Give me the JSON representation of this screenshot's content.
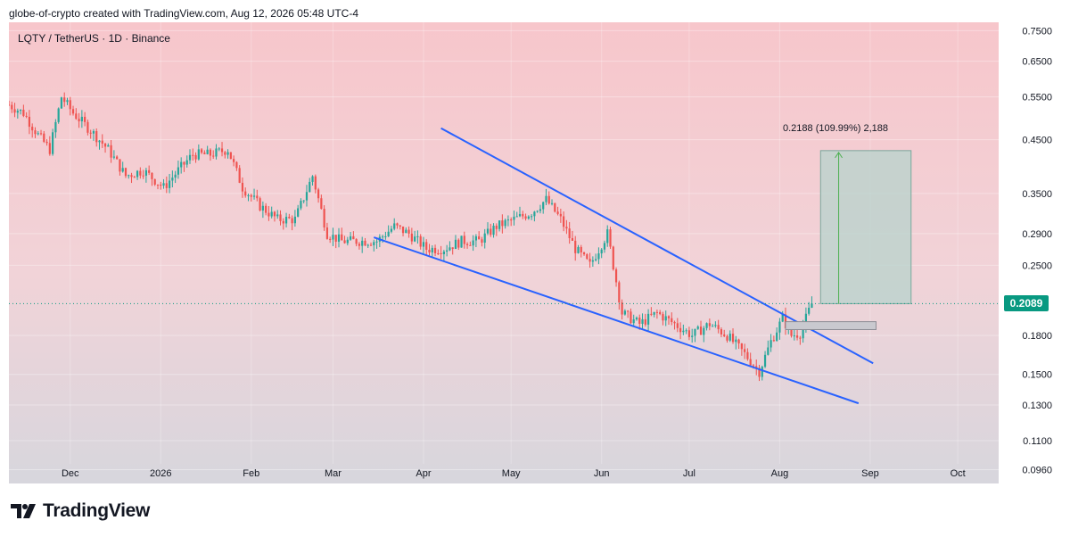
{
  "header": {
    "attribution": "globe-of-crypto created with TradingView.com, Aug 12, 2026 05:48 UTC-4"
  },
  "symbol_label": "LQTY / TetherUS · 1D · Binance",
  "footer": {
    "brand": "TradingView",
    "logo_icon": "tradingview-logo-icon"
  },
  "current_price": "0.2089",
  "measure": {
    "label": "0.2188 (109.99%) 2,188",
    "from": 0.2089,
    "to": 0.4277
  },
  "colors": {
    "up": "#26a69a",
    "down": "#ef5350",
    "trendline": "#2962ff",
    "badge": "#089981",
    "bg_top": "#f7c6cb",
    "bg_bottom": "#d9d6dc",
    "measure_fill": "#b7d3cc"
  },
  "chart_data": {
    "type": "candlestick",
    "scale": "log",
    "ylim": [
      0.09,
      0.78
    ],
    "y_ticks": [
      "0.7500",
      "0.6500",
      "0.5500",
      "0.4500",
      "0.3500",
      "0.2900",
      "0.2500",
      "0.1800",
      "0.1500",
      "0.1300",
      "0.1100",
      "0.0960"
    ],
    "x_ticks": [
      "Dec",
      "2026",
      "Feb",
      "Mar",
      "Apr",
      "May",
      "Jun",
      "Jul",
      "Aug",
      "Sep",
      "Oct"
    ],
    "x_range": [
      "2025-11-10",
      "2026-10-15"
    ],
    "series": [
      {
        "name": "close_path",
        "points": [
          [
            "2025-11-10",
            0.53
          ],
          [
            "2025-11-15",
            0.51
          ],
          [
            "2025-11-20",
            0.46
          ],
          [
            "2025-11-24",
            0.43
          ],
          [
            "2025-11-28",
            0.55
          ],
          [
            "2025-12-02",
            0.51
          ],
          [
            "2025-12-08",
            0.47
          ],
          [
            "2025-12-14",
            0.43
          ],
          [
            "2025-12-20",
            0.38
          ],
          [
            "2025-12-26",
            0.39
          ],
          [
            "2026-01-02",
            0.36
          ],
          [
            "2026-01-07",
            0.39
          ],
          [
            "2026-01-12",
            0.42
          ],
          [
            "2026-01-18",
            0.42
          ],
          [
            "2026-01-24",
            0.43
          ],
          [
            "2026-01-29",
            0.36
          ],
          [
            "2026-02-04",
            0.33
          ],
          [
            "2026-02-10",
            0.31
          ],
          [
            "2026-02-16",
            0.31
          ],
          [
            "2026-02-22",
            0.38
          ],
          [
            "2026-02-27",
            0.29
          ],
          [
            "2026-03-04",
            0.28
          ],
          [
            "2026-03-10",
            0.28
          ],
          [
            "2026-03-16",
            0.28
          ],
          [
            "2026-03-22",
            0.3
          ],
          [
            "2026-03-27",
            0.29
          ],
          [
            "2026-04-02",
            0.27
          ],
          [
            "2026-04-08",
            0.27
          ],
          [
            "2026-04-14",
            0.28
          ],
          [
            "2026-04-20",
            0.28
          ],
          [
            "2026-04-26",
            0.3
          ],
          [
            "2026-05-02",
            0.31
          ],
          [
            "2026-05-08",
            0.32
          ],
          [
            "2026-05-13",
            0.34
          ],
          [
            "2026-05-18",
            0.31
          ],
          [
            "2026-05-23",
            0.27
          ],
          [
            "2026-05-28",
            0.25
          ],
          [
            "2026-06-03",
            0.29
          ],
          [
            "2026-06-08",
            0.2
          ],
          [
            "2026-06-14",
            0.19
          ],
          [
            "2026-06-20",
            0.2
          ],
          [
            "2026-06-26",
            0.19
          ],
          [
            "2026-07-02",
            0.18
          ],
          [
            "2026-07-08",
            0.19
          ],
          [
            "2026-07-14",
            0.18
          ],
          [
            "2026-07-20",
            0.165
          ],
          [
            "2026-07-25",
            0.152
          ],
          [
            "2026-07-29",
            0.175
          ],
          [
            "2026-08-02",
            0.195
          ],
          [
            "2026-08-05",
            0.18
          ],
          [
            "2026-08-08",
            0.182
          ],
          [
            "2026-08-12",
            0.2089
          ]
        ]
      }
    ],
    "annotations": [
      {
        "type": "trendline",
        "name": "falling-wedge-upper",
        "from": [
          "2026-04-07",
          0.475
        ],
        "to": [
          "2026-09-02",
          0.158
        ]
      },
      {
        "type": "trendline",
        "name": "falling-wedge-lower",
        "from": [
          "2026-03-15",
          0.285
        ],
        "to": [
          "2026-08-28",
          0.131
        ]
      },
      {
        "type": "rectangle",
        "name": "support-zone",
        "from": [
          "2026-08-03",
          0.192
        ],
        "to": [
          "2026-09-03",
          0.185
        ]
      },
      {
        "type": "price-range",
        "name": "target-measure",
        "from": [
          "2026-08-15",
          0.4277
        ],
        "to": [
          "2026-09-15",
          0.2089
        ]
      }
    ]
  }
}
